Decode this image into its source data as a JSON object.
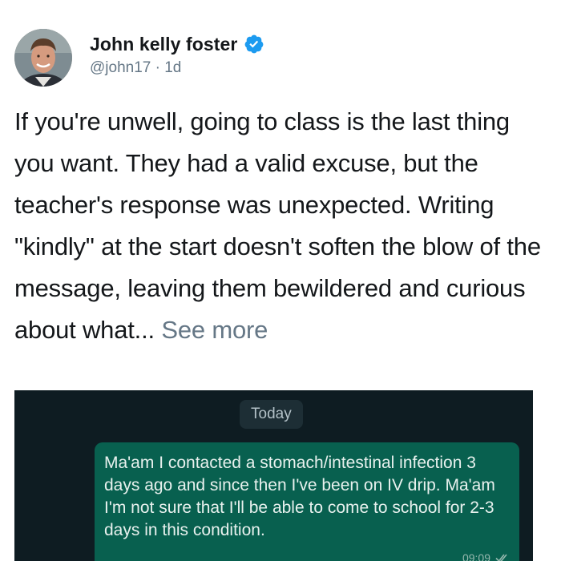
{
  "author": {
    "display_name": "John kelly foster",
    "handle": "@john17",
    "time_ago": "1d",
    "separator": "·",
    "verified": true,
    "avatar_icon": "profile-photo",
    "verified_icon": "verified-badge-icon",
    "verified_color": "#1d9bf0"
  },
  "tweet": {
    "text": "If you're unwell, going to class is the last thing you want. They had a valid excuse, but the teacher's response was unexpected. Writing \"kindly\" at the start doesn't soften the blow of the message, leaving them bewildered and curious about what...",
    "see_more": "See more"
  },
  "chat_screenshot": {
    "date_label": "Today",
    "message": {
      "text": "Ma'am I contacted a stomach/intestinal infection 3 days ago and since then I've been on IV drip. Ma'am I'm not sure that I'll be able to come to school for 2-3 days in this condition.",
      "time": "09:09",
      "status_icon": "double-check-icon"
    },
    "colors": {
      "background": "#0e1c22",
      "bubble": "#08604f",
      "date_chip": "#1d2e35"
    }
  }
}
